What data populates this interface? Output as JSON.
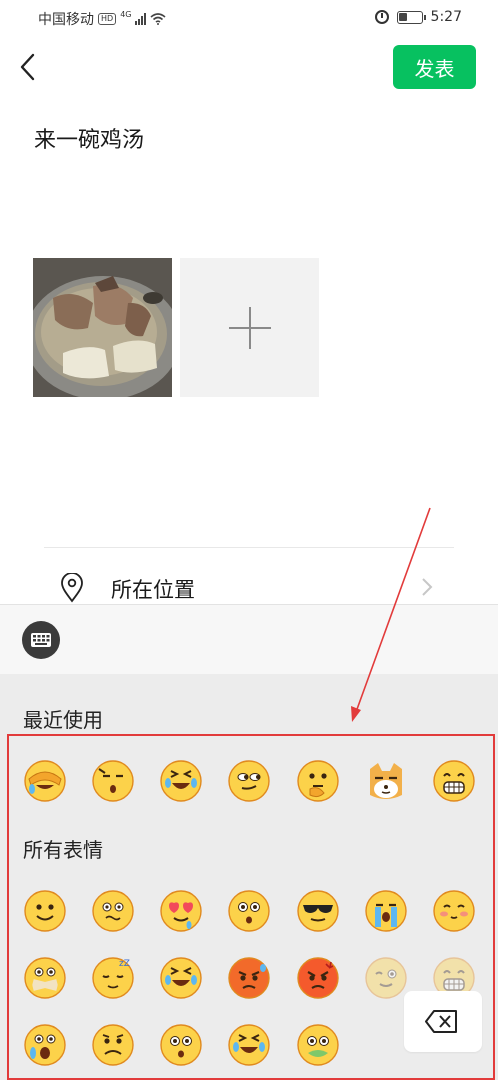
{
  "status_bar": {
    "carrier": "中国移动",
    "network_badge": "HD",
    "network_type": "4G",
    "time": "5:27",
    "battery_level": 0.4
  },
  "header": {
    "back_icon": "chevron-left-icon",
    "publish_label": "发表",
    "accent_color": "#07c160"
  },
  "post": {
    "text": "来一碗鸡汤",
    "photos": [
      {
        "description_icon": "chicken-soup-photo"
      }
    ],
    "add_photo_icon": "plus-icon"
  },
  "location": {
    "icon": "location-pin-icon",
    "label": "所在位置"
  },
  "emoji_panel": {
    "keyboard_icon": "keyboard-icon",
    "recent_title": "最近使用",
    "all_title": "所有表情",
    "backspace_icon": "backspace-icon",
    "highlight_color": "#e23b3b",
    "recent": [
      "facepalm",
      "smug",
      "tears-of-joy",
      "side-eye",
      "thinking",
      "doge",
      "grin"
    ],
    "all": [
      [
        "smile",
        "awkward",
        "heart-eyes",
        "surprised",
        "cool",
        "crying",
        "blush"
      ],
      [
        "shush",
        "sleepy",
        "squint-cry",
        "sweat-angry",
        "angry",
        "wink",
        "grin-faded"
      ],
      [
        "scared",
        "sad",
        "worried",
        "laugh-cry",
        "sick"
      ]
    ]
  }
}
